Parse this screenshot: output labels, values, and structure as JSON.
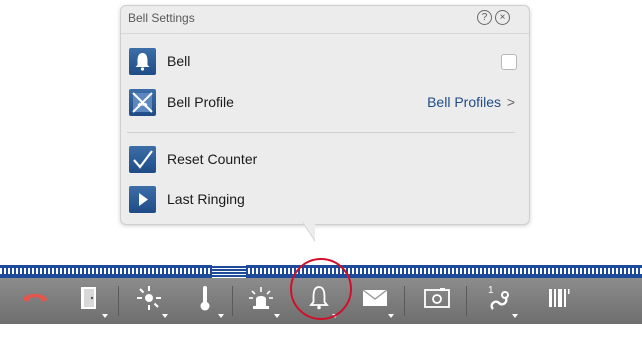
{
  "popover": {
    "title": "Bell Settings",
    "help_glyph": "?",
    "close_glyph": "×",
    "rows": [
      {
        "label": "Bell",
        "icon": "bell-icon",
        "control": "checkbox",
        "checked": false
      },
      {
        "label": "Bell Profile",
        "icon": "bell-profile-icon",
        "link": "Bell Profiles",
        "chevron": ">"
      },
      {
        "label": "Reset Counter",
        "icon": "checkmark-icon"
      },
      {
        "label": "Last Ringing",
        "icon": "play-icon"
      }
    ]
  },
  "toolbar": {
    "items": [
      {
        "icon": "hangup-icon"
      },
      {
        "icon": "door-icon"
      },
      {
        "icon": "light-icon"
      },
      {
        "icon": "thermometer-icon"
      },
      {
        "icon": "alarm-icon"
      },
      {
        "icon": "bell-icon",
        "highlighted": true
      },
      {
        "icon": "mail-icon"
      },
      {
        "icon": "camera-icon"
      },
      {
        "icon": "connection-icon"
      },
      {
        "icon": "barcode-icon"
      }
    ]
  },
  "colors": {
    "accent": "#1e4a9b",
    "highlight": "#d0102a",
    "link": "#1f4c86"
  }
}
